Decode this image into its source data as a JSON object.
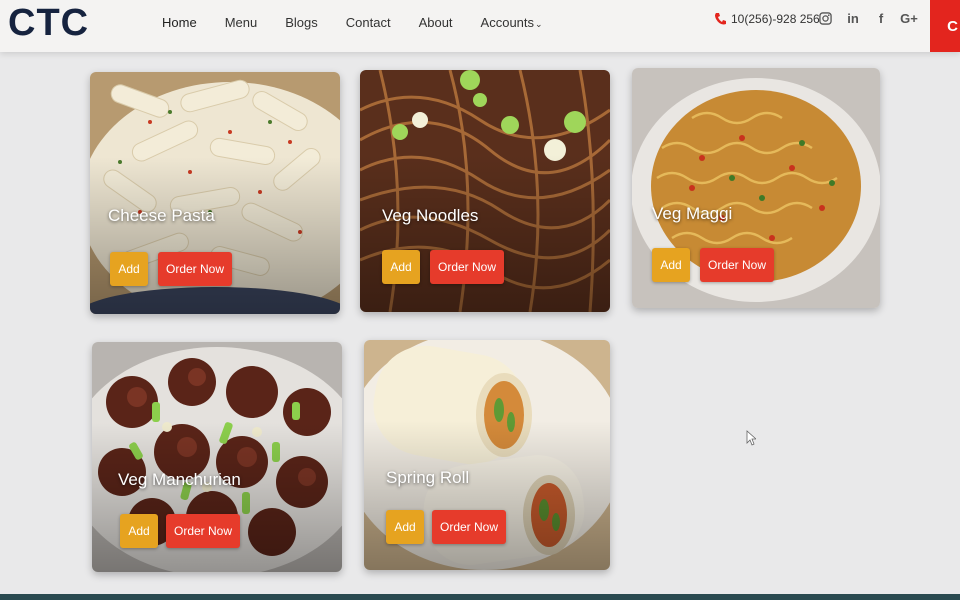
{
  "brand": {
    "logo": "CTC"
  },
  "nav": {
    "items": [
      {
        "label": "Home"
      },
      {
        "label": "Menu"
      },
      {
        "label": "Blogs"
      },
      {
        "label": "Contact"
      },
      {
        "label": "About"
      },
      {
        "label": "Accounts"
      }
    ],
    "accounts_caret": "⌄"
  },
  "contact": {
    "phone": "10(256)-928 256"
  },
  "socials": [
    {
      "icon": "instagram-icon"
    },
    {
      "icon": "linkedin-icon",
      "text": "in"
    },
    {
      "icon": "facebook-icon",
      "text": "f"
    },
    {
      "icon": "google-plus-icon",
      "text": "G+"
    }
  ],
  "header_right_letter": "C",
  "cards": [
    {
      "title": "Cheese Pasta",
      "add": "Add",
      "order": "Order Now"
    },
    {
      "title": "Veg Noodles",
      "add": "Add",
      "order": "Order Now"
    },
    {
      "title": "Veg Maggi",
      "add": "Add",
      "order": "Order Now"
    },
    {
      "title": "Veg Manchurian",
      "add": "Add",
      "order": "Order Now"
    },
    {
      "title": "Spring Roll",
      "add": "Add",
      "order": "Order Now"
    }
  ],
  "colors": {
    "add": "#e6a320",
    "order": "#e63b2b",
    "accent": "#e3251e",
    "logo": "#16233f"
  }
}
